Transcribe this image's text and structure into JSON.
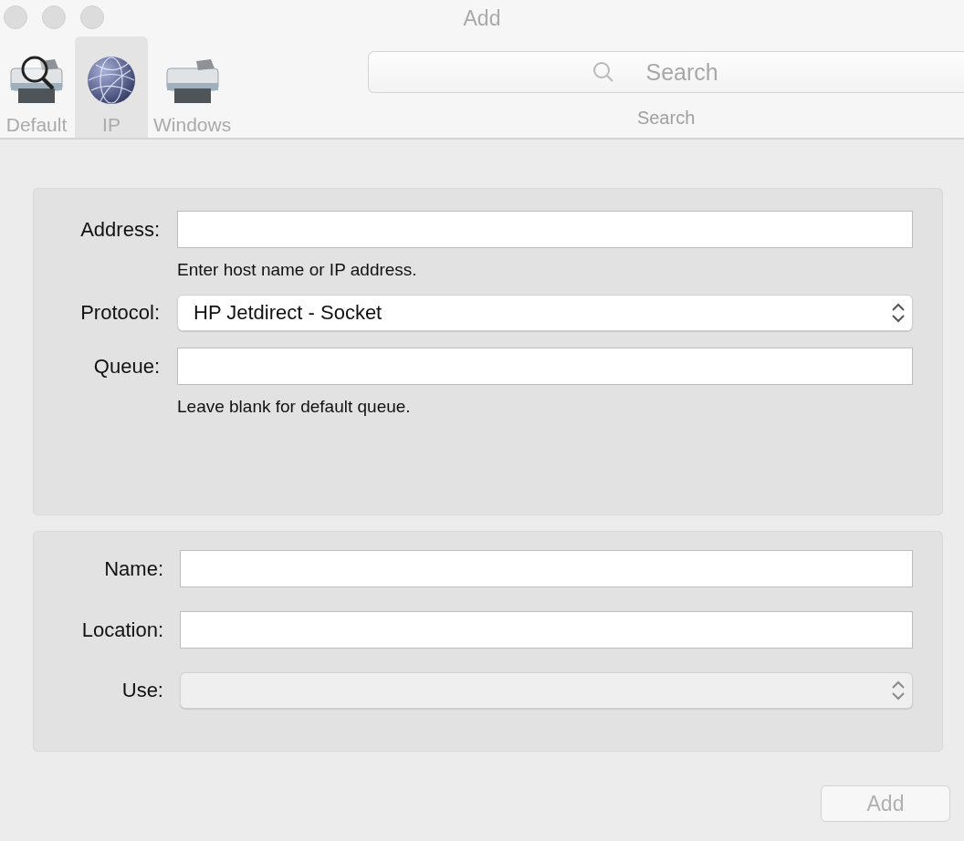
{
  "window": {
    "title": "Add"
  },
  "toolbar": {
    "tabs": [
      {
        "label": "Default",
        "kind": "printer-search",
        "selected": false
      },
      {
        "label": "IP",
        "kind": "globe",
        "selected": true
      },
      {
        "label": "Windows",
        "kind": "printer",
        "selected": false
      }
    ],
    "search": {
      "placeholder": "Search",
      "label": "Search"
    }
  },
  "sections": [
    {
      "rows": [
        {
          "kind": "text",
          "label": "Address:",
          "hint": "Enter host name or IP address."
        },
        {
          "kind": "select",
          "label": "Protocol:",
          "value": "HP Jetdirect - Socket",
          "disabled": false
        },
        {
          "kind": "text",
          "label": "Queue:",
          "hint": "Leave blank for default queue."
        }
      ]
    },
    {
      "rows": [
        {
          "kind": "text",
          "label": "Name:"
        },
        {
          "kind": "text",
          "label": "Location:"
        },
        {
          "kind": "select",
          "label": "Use:",
          "disabled": true
        }
      ]
    }
  ],
  "add_button": {
    "label": "Add",
    "disabled": true
  }
}
